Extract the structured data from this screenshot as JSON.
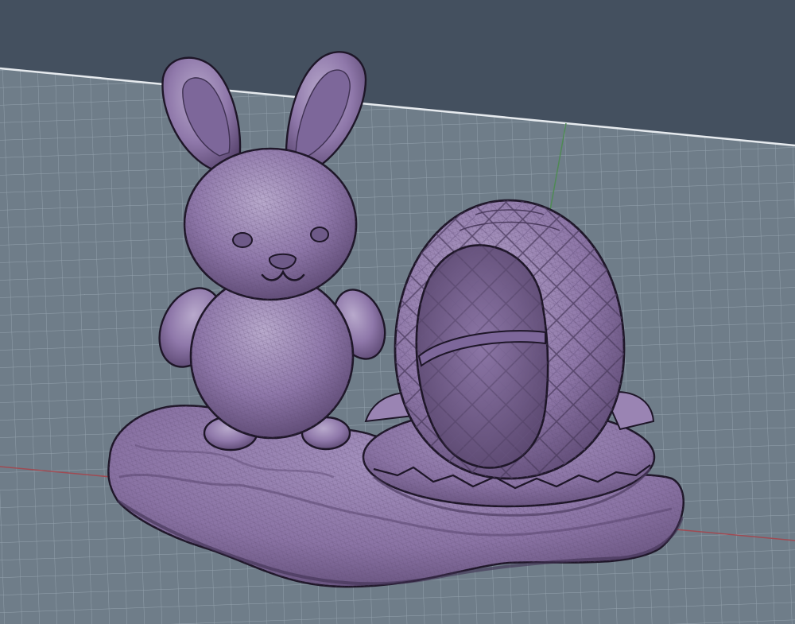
{
  "viewport": {
    "background_color": "#44505f",
    "grid_fill_color": "#6f7d89",
    "grid_line_color": "#95a3ae",
    "horizon_line_color": "#e6eaee",
    "axis_x_color": "#a04a52",
    "axis_y_color": "#4f8a55"
  },
  "model": {
    "mesh_color": "#8e77a8",
    "mesh_highlight_color": "#b9a8d0",
    "mesh_shadow_color": "#4e3d62",
    "outline_color": "#1e1628",
    "parts": [
      "bunny",
      "egg-basket",
      "leaf-cup",
      "ground-base"
    ]
  }
}
